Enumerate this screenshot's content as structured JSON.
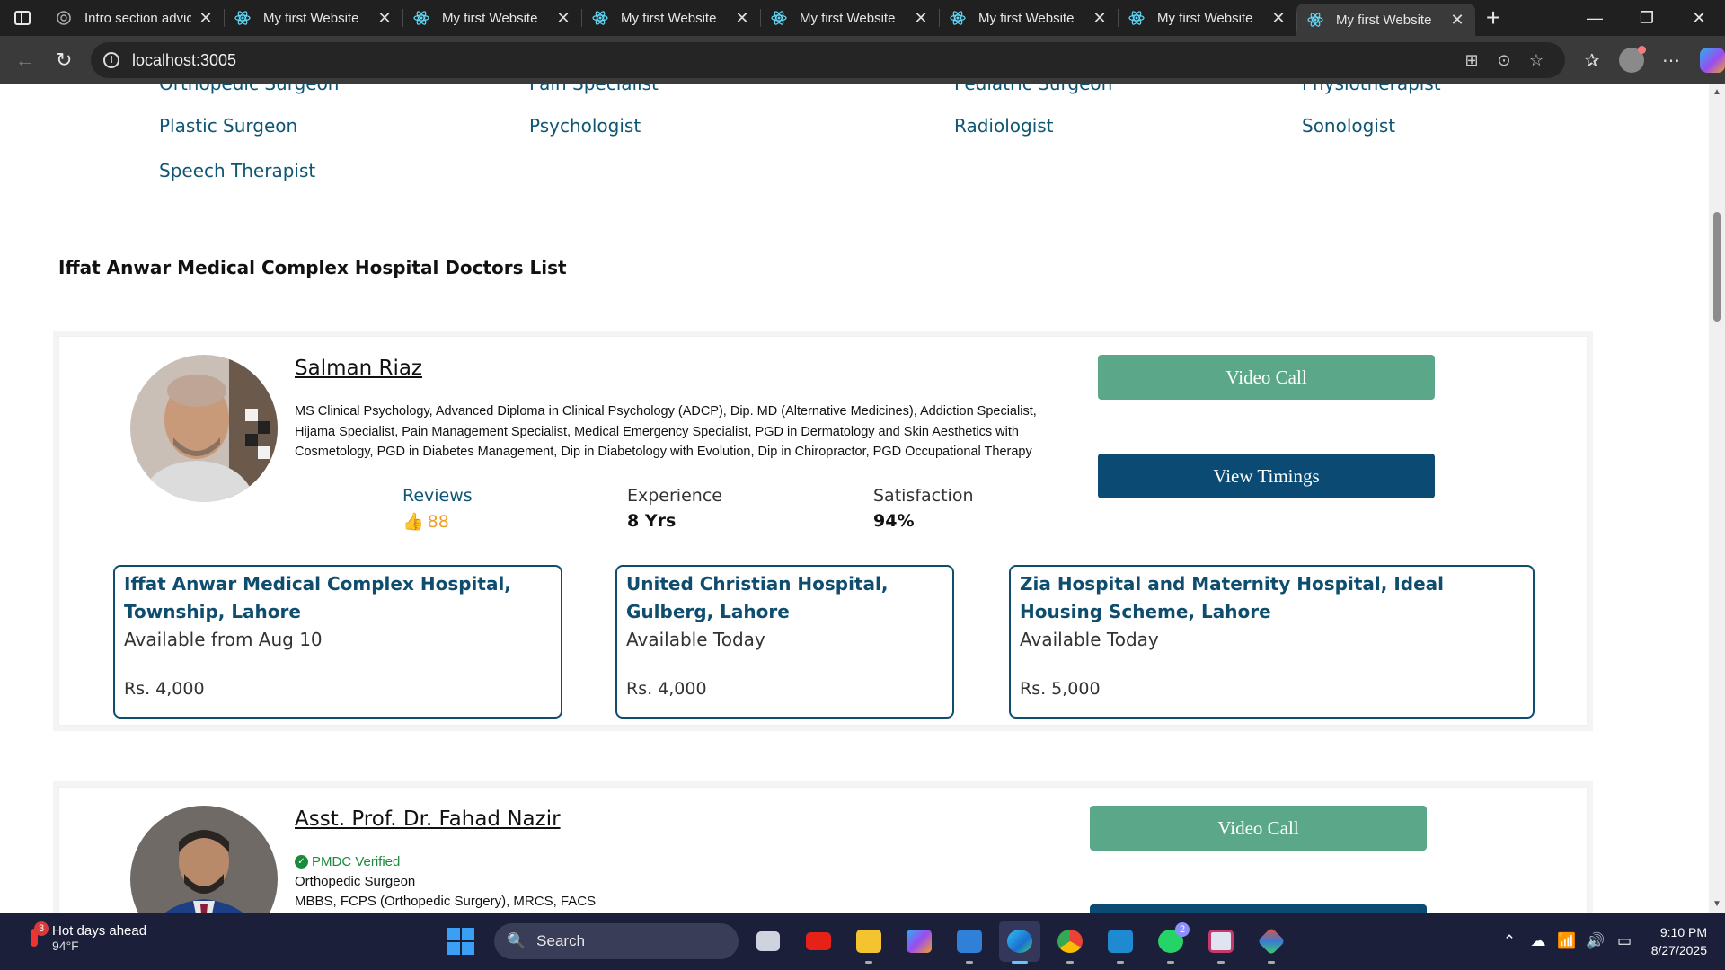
{
  "browser": {
    "tabs": [
      {
        "title": "Intro section advic",
        "active": false
      },
      {
        "title": "My first Website",
        "active": false
      },
      {
        "title": "My first Website",
        "active": false
      },
      {
        "title": "My first Website",
        "active": false
      },
      {
        "title": "My first Website",
        "active": false
      },
      {
        "title": "My first Website",
        "active": false
      },
      {
        "title": "My first Website",
        "active": false
      },
      {
        "title": "My first Website",
        "active": true
      }
    ],
    "url": "localhost:3005"
  },
  "specialties": {
    "row0": [
      "Orthopedic Surgeon",
      "Pain Specialist",
      "Pediatric Surgeon",
      "Physiotherapist"
    ],
    "row1": [
      "Plastic Surgeon",
      "Psychologist",
      "Radiologist",
      "Sonologist"
    ],
    "row2": [
      "Speech Therapist"
    ]
  },
  "section_title": "Iffat Anwar Medical Complex Hospital Doctors List",
  "doctors": [
    {
      "name": "Salman Riaz",
      "qualifications": "MS Clinical Psychology, Advanced Diploma in Clinical Psychology (ADCP), Dip. MD (Alternative Medicines), Addiction Specialist, Hijama Specialist, Pain Management Specialist, Medical Emergency Specialist, PGD in Dermatology and Skin Aesthetics with Cosmetology, PGD in Diabetes Management, Dip in Diabetology with Evolution, Dip in Chiropractor, PGD Occupational Therapy",
      "reviews_label": "Reviews",
      "reviews_value": "88",
      "experience_label": "Experience",
      "experience_value": "8 Yrs",
      "satisfaction_label": "Satisfaction",
      "satisfaction_value": "94%",
      "video_call_label": "Video Call",
      "view_timings_label": "View Timings",
      "hospitals": [
        {
          "name": "Iffat Anwar Medical Complex Hospital, Township, Lahore",
          "availability": "Available from Aug 10",
          "fee": "Rs. 4,000"
        },
        {
          "name": "United Christian Hospital, Gulberg, Lahore",
          "availability": "Available Today",
          "fee": "Rs. 4,000"
        },
        {
          "name": "Zia Hospital and Maternity Hospital, Ideal Housing Scheme, Lahore",
          "availability": "Available Today",
          "fee": "Rs. 5,000"
        }
      ]
    },
    {
      "name": "Asst. Prof. Dr. Fahad Nazir",
      "verified_label": "PMDC Verified",
      "specialty": "Orthopedic Surgeon",
      "qualifications": "MBBS, FCPS (Orthopedic Surgery), MRCS, FACS",
      "video_call_label": "Video Call"
    }
  ],
  "taskbar": {
    "weather_title": "Hot days ahead",
    "weather_temp": "94°F",
    "weather_badge": "3",
    "search_label": "Search",
    "whatsapp_badge": "2",
    "time": "9:10 PM",
    "date": "8/27/2025"
  },
  "colors": {
    "link_blue": "#0f5675",
    "video_green": "#5aa889",
    "timings_navy": "#0a4a73",
    "rating_orange": "#f0a020"
  }
}
